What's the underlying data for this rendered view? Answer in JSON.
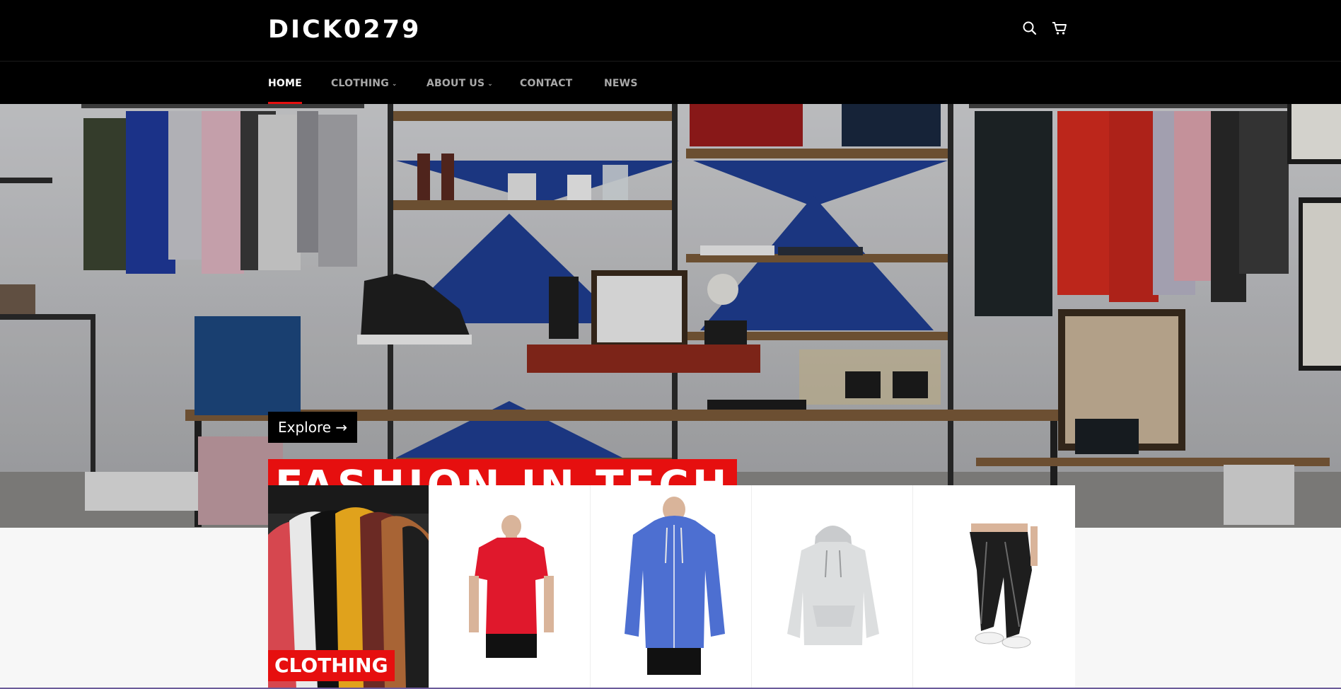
{
  "store": {
    "name": "DICK0279"
  },
  "header": {
    "icons": [
      "search-icon",
      "cart-icon"
    ]
  },
  "nav": {
    "items": [
      {
        "label": "HOME",
        "active": true,
        "dropdown": false
      },
      {
        "label": "CLOTHING",
        "active": false,
        "dropdown": true
      },
      {
        "label": "ABOUT US",
        "active": false,
        "dropdown": true
      },
      {
        "label": "CONTACT",
        "active": false,
        "dropdown": false
      },
      {
        "label": "NEWS",
        "active": false,
        "dropdown": false
      }
    ]
  },
  "hero": {
    "title": "FASHION IN TECH",
    "button_label": "Explore →"
  },
  "collection": {
    "featured_label": "CLOTHING",
    "products": [
      "red-t-shirt",
      "blue-zip-hoodie",
      "grey-hoodie",
      "black-joggers"
    ]
  },
  "colors": {
    "accent": "#e60f0f",
    "header_bg": "#000000",
    "nav_inactive": "#a9a9a9",
    "page_bg": "#f7f7f7"
  }
}
